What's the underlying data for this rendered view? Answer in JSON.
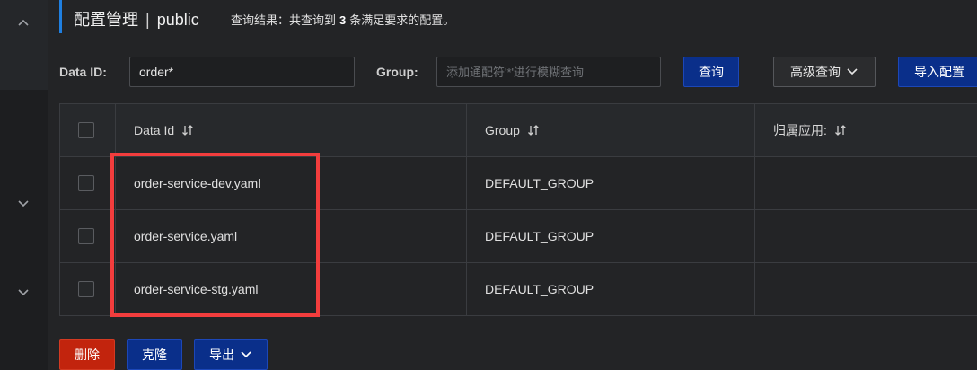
{
  "header": {
    "title": "配置管理",
    "separator": "|",
    "namespace": "public",
    "result_prefix": "查询结果：共查询到",
    "result_count": "3",
    "result_suffix": "条满足要求的配置。"
  },
  "search": {
    "dataid_label": "Data ID:",
    "dataid_value": "order*",
    "group_label": "Group:",
    "group_placeholder": "添加通配符'*'进行模糊查询",
    "query_button": "查询",
    "advanced_button": "高级查询",
    "import_button": "导入配置"
  },
  "table": {
    "columns": [
      "Data Id",
      "Group",
      "归属应用:"
    ],
    "rows": [
      {
        "data_id": "order-service-dev.yaml",
        "group": "DEFAULT_GROUP",
        "app": ""
      },
      {
        "data_id": "order-service.yaml",
        "group": "DEFAULT_GROUP",
        "app": ""
      },
      {
        "data_id": "order-service-stg.yaml",
        "group": "DEFAULT_GROUP",
        "app": ""
      }
    ]
  },
  "footer": {
    "delete_button": "删除",
    "clone_button": "克隆",
    "export_button": "导出"
  },
  "colors": {
    "accent": "#1f7fe0",
    "primary": "#0a2f8a",
    "danger": "#c2240d",
    "highlight": "#f23d3d"
  },
  "icons": [
    "chevron-up-icon",
    "chevron-down-icon",
    "sort-icon",
    "checkbox-icon"
  ]
}
